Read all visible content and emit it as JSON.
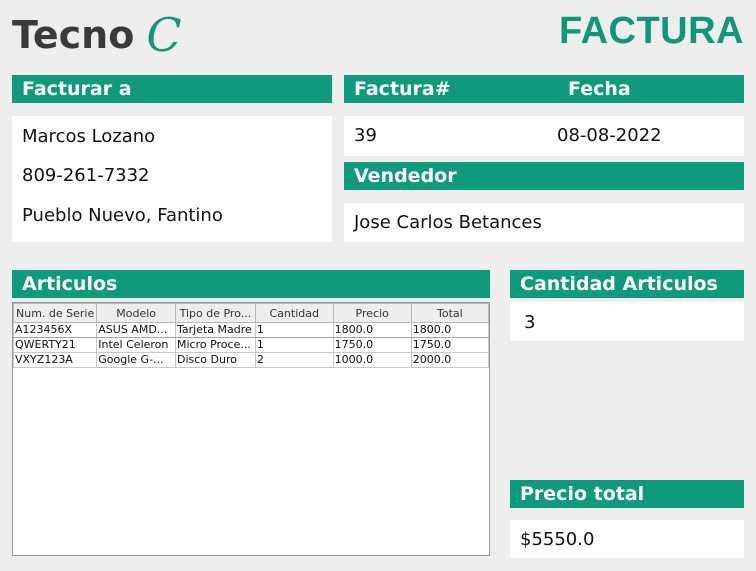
{
  "brand": {
    "name": "Tecno",
    "mark": "C"
  },
  "doc_title": "FACTURA",
  "bill_to": {
    "header": "Facturar a",
    "name": "Marcos Lozano",
    "phone": "809-261-7332",
    "address": "Pueblo Nuevo, Fantino"
  },
  "invoice": {
    "number_header": "Factura#",
    "date_header": "Fecha",
    "number": "39",
    "date": "08-08-2022"
  },
  "seller": {
    "header": "Vendedor",
    "name": "Jose Carlos Betances"
  },
  "articles": {
    "header": "Articulos",
    "columns": [
      "Num. de Serie",
      "Modelo",
      "Tipo de Pro...",
      "Cantidad",
      "Precio",
      "Total"
    ],
    "rows": [
      [
        "A123456X",
        "ASUS AMD...",
        "Tarjeta Madre",
        "1",
        "1800.0",
        "1800.0"
      ],
      [
        "QWERTY21",
        "Intel Celeron",
        "Micro Proce...",
        "1",
        "1750.0",
        "1750.0"
      ],
      [
        "VXYZ123A",
        "Google G-...",
        "Disco Duro",
        "2",
        "1000.0",
        "2000.0"
      ]
    ]
  },
  "quantity": {
    "header": "Cantidad Articulos",
    "value": "3"
  },
  "total": {
    "header": "Precio total",
    "value": "$5550.0"
  },
  "colors": {
    "accent": "#0f9a7c",
    "background": "#eeeeee"
  }
}
